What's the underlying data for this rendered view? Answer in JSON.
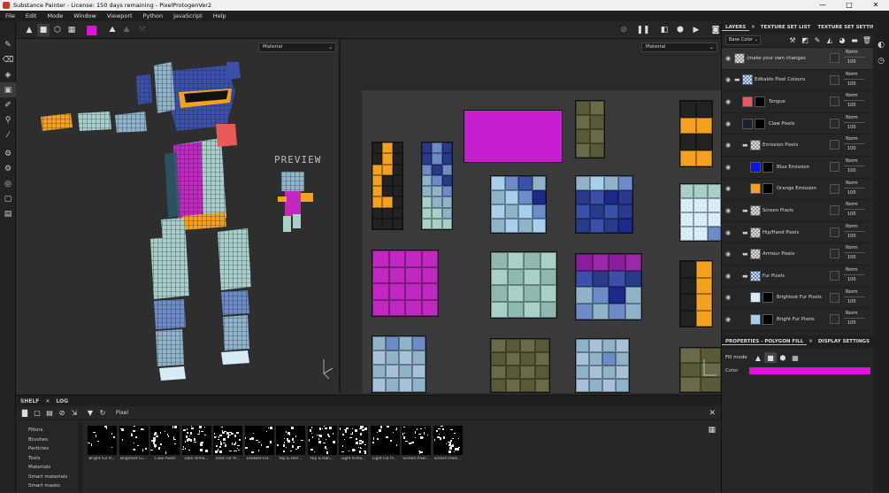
{
  "window": {
    "title": "Substance Painter - License: 150 days remaining - PixelProtogenVer2",
    "controls": [
      "—",
      "□",
      "✕"
    ]
  },
  "menu": [
    "File",
    "Edit",
    "Mode",
    "Window",
    "Viewport",
    "Python",
    "JavaScript",
    "Help"
  ],
  "accent_color": "#e010e0",
  "viewport": {
    "left_dropdown": "Material",
    "right_dropdown": "Material",
    "preview_label": "PREVIEW"
  },
  "layers_panel": {
    "tabs": [
      "LAYERS",
      "TEXTURE SET LIST",
      "TEXTURE SET SETTINGS"
    ],
    "channel": "Base Color",
    "layers": [
      {
        "name": "(make your own changes above t...",
        "blend": "Norm",
        "opacity": "100",
        "thumb": "checker",
        "folder": false,
        "indent": 0
      },
      {
        "name": "Editable Pixel Colours",
        "blend": "Norm",
        "opacity": "100",
        "thumb": "blue-checker",
        "folder": true,
        "indent": 0
      },
      {
        "name": "Tongue",
        "blend": "Norm",
        "opacity": "100",
        "thumb": "#e85a5a",
        "folder": false,
        "indent": 1
      },
      {
        "name": "Claw Pixels",
        "blend": "Norm",
        "opacity": "100",
        "thumb": "#1e2030",
        "folder": false,
        "indent": 1
      },
      {
        "name": "Emission Pixels",
        "blend": "Norm",
        "opacity": "100",
        "thumb": "checker",
        "folder": true,
        "indent": 1
      },
      {
        "name": "Blue Emission",
        "blend": "Norm",
        "opacity": "100",
        "thumb": "#0a14e6",
        "folder": false,
        "indent": 2
      },
      {
        "name": "Orange Emission",
        "blend": "Norm",
        "opacity": "100",
        "thumb": "#f5a01e",
        "folder": false,
        "indent": 2
      },
      {
        "name": "Screen Pixels",
        "blend": "Norm",
        "opacity": "100",
        "thumb": "checker",
        "folder": true,
        "indent": 1
      },
      {
        "name": "Hip/Hand Pixels",
        "blend": "Norm",
        "opacity": "100",
        "thumb": "checker",
        "folder": true,
        "indent": 1
      },
      {
        "name": "Armour Pixels",
        "blend": "Norm",
        "opacity": "100",
        "thumb": "checker",
        "folder": true,
        "indent": 1
      },
      {
        "name": "Fur Pixels",
        "blend": "Norm",
        "opacity": "100",
        "thumb": "blue-checker",
        "folder": true,
        "indent": 1
      },
      {
        "name": "Brightest Fur Pixels",
        "blend": "Norm",
        "opacity": "100",
        "thumb": "#d8ecf8",
        "folder": false,
        "indent": 2
      },
      {
        "name": "Bright Fur Pixels",
        "blend": "Norm",
        "opacity": "100",
        "thumb": "#a8d0ec",
        "folder": false,
        "indent": 2
      }
    ]
  },
  "properties": {
    "tabs": [
      "PROPERTIES - POLYGON FILL",
      "DISPLAY SETTINGS"
    ],
    "fill_mode_label": "Fill mode",
    "color_label": "Color",
    "color_value": "#e010e0"
  },
  "shelf": {
    "tabs": [
      "SHELF",
      "LOG"
    ],
    "search": "Pixel",
    "categories": [
      "Filters",
      "Brushes",
      "Particles",
      "Tools",
      "Materials",
      "Smart materials",
      "Smart masks"
    ],
    "items": [
      "Bright Fur Pi...",
      "Brightest Fu...",
      "Claw Pixels",
      "Dark Armo...",
      "Dark Fur Pi...",
      "Darkest Fur...",
      "Hip & Han...",
      "Hip & Han...",
      "Light Armo...",
      "Light Fur Pi...",
      "Screen Pixel...",
      "Screen Pixel..."
    ]
  }
}
